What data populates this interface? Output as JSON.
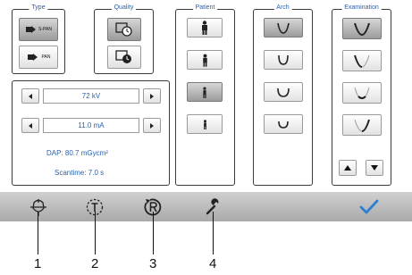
{
  "type_group": {
    "title": "Type",
    "buttons": [
      {
        "label": "S-PAN"
      },
      {
        "label": "PAN"
      }
    ]
  },
  "quality_group": {
    "title": "Quality"
  },
  "params": {
    "kv": "72 kV",
    "ma": "11.0 mA",
    "dap": "DAP: 80.7 mGycm²",
    "scantime": "Scantime: 7.0 s"
  },
  "patient_group": {
    "title": "Patient",
    "selected_index": 2
  },
  "arch_group": {
    "title": "Arch",
    "selected_index": 0
  },
  "examination_group": {
    "title": "Examination",
    "selected_index": 0
  },
  "bottom_bar": {
    "icons": [
      "positioning-icon",
      "timer-icon",
      "reset-icon",
      "wrench-icon",
      "checkmark-icon"
    ]
  },
  "callouts": [
    "1",
    "2",
    "3",
    "4"
  ],
  "colors": {
    "accent": "#2b5fa8",
    "bar": "#b9b9b9",
    "selected": "#a8a8a8",
    "check": "#2f7fd1"
  }
}
